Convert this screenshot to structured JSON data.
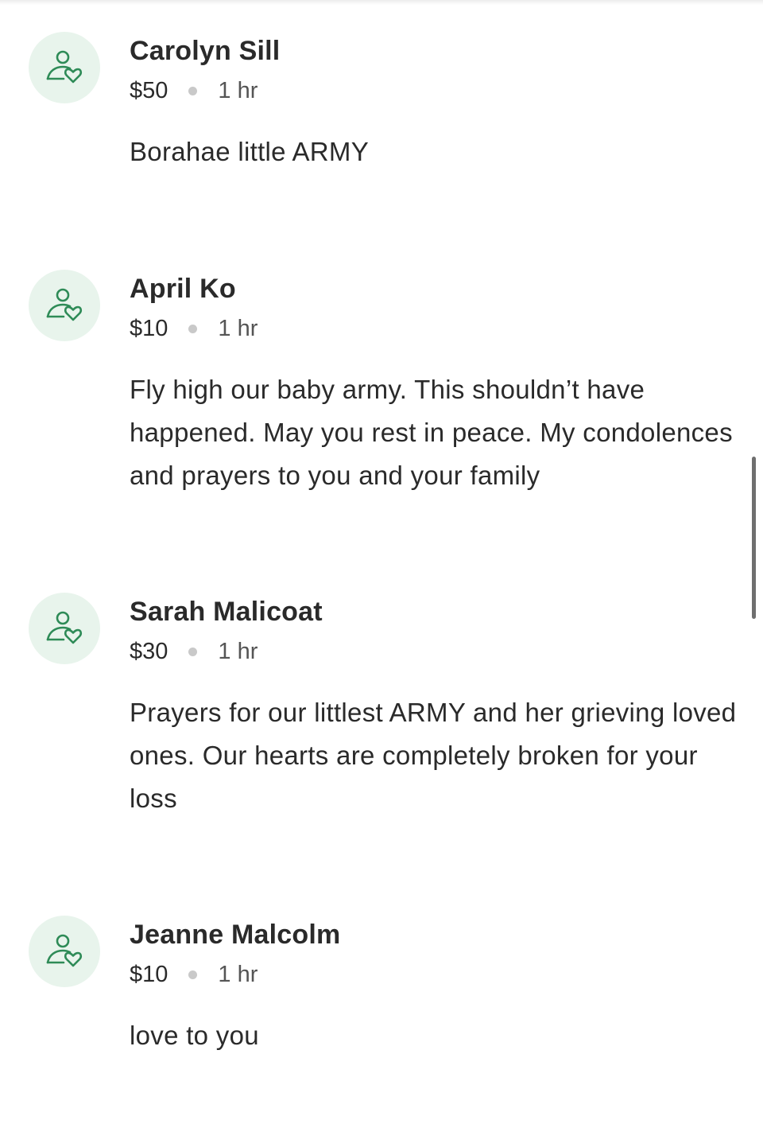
{
  "colors": {
    "avatar_bg": "#e8f4ec",
    "avatar_icon": "#2e8b57",
    "text": "#2a2a2a",
    "dot": "#c9c9c9"
  },
  "icon": "donor-heart-icon",
  "donations": [
    {
      "name": "Carolyn Sill",
      "amount": "$50",
      "time": "1 hr",
      "message": "Borahae little ARMY"
    },
    {
      "name": "April Ko",
      "amount": "$10",
      "time": "1 hr",
      "message": "Fly high our baby army. This shouldn’t have happened. May you rest in peace. My condolences and prayers to you and your family"
    },
    {
      "name": "Sarah Malicoat",
      "amount": "$30",
      "time": "1 hr",
      "message": "Prayers for our littlest ARMY and her grieving loved ones. Our hearts are completely broken for your loss"
    },
    {
      "name": "Jeanne Malcolm",
      "amount": "$10",
      "time": "1 hr",
      "message": "love to you"
    }
  ]
}
